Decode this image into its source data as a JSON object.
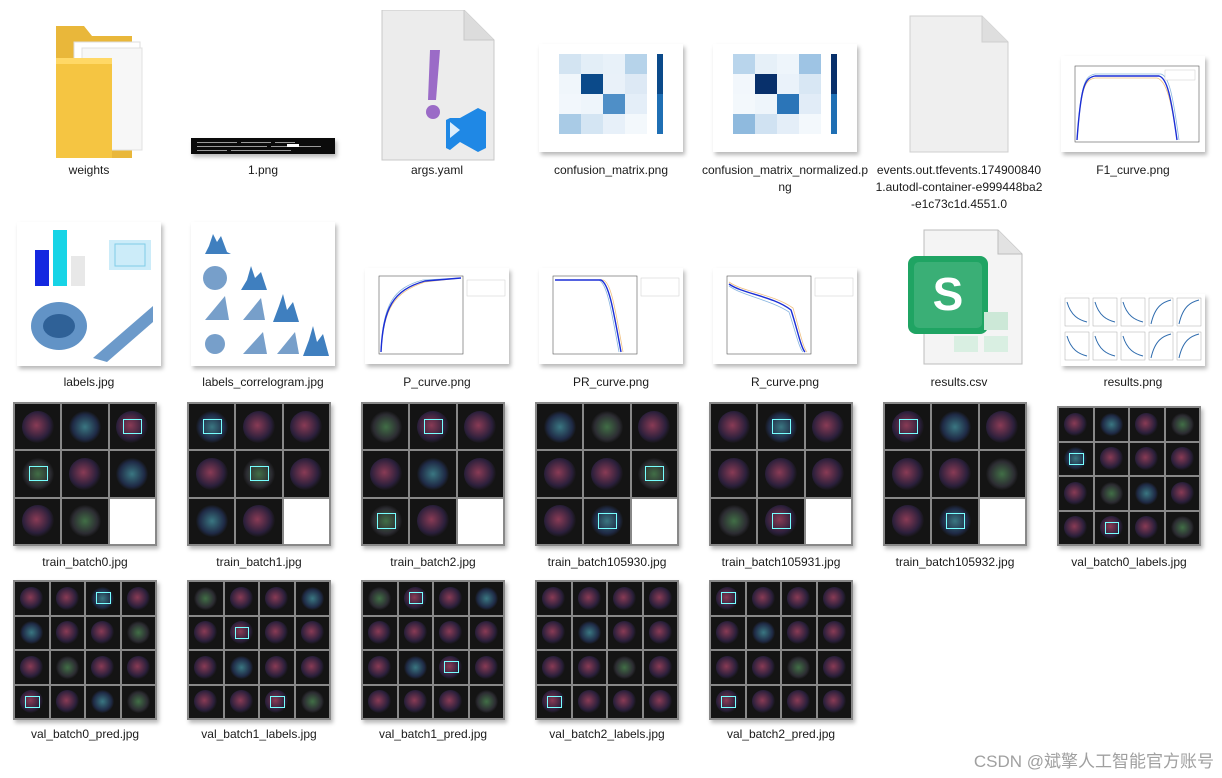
{
  "files": [
    {
      "name": "weights",
      "icon": "folder-icon"
    },
    {
      "name": "1.png",
      "icon": "terminal-screenshot-thumbnail"
    },
    {
      "name": "args.yaml",
      "icon": "vscode-yaml-file-icon"
    },
    {
      "name": "confusion_matrix.png",
      "icon": "heatmap-thumbnail"
    },
    {
      "name": "confusion_matrix_normalized.png",
      "icon": "heatmap-thumbnail"
    },
    {
      "name": "events.out.tfevents.1749008401.autodl-container-e999448ba2-e1c73c1d.4551.0",
      "icon": "blank-file-icon"
    },
    {
      "name": "F1_curve.png",
      "icon": "curve-chart-thumbnail"
    },
    {
      "name": "labels.jpg",
      "icon": "labels-chart-thumbnail"
    },
    {
      "name": "labels_correlogram.jpg",
      "icon": "correlogram-thumbnail"
    },
    {
      "name": "P_curve.png",
      "icon": "curve-chart-thumbnail"
    },
    {
      "name": "PR_curve.png",
      "icon": "curve-chart-thumbnail"
    },
    {
      "name": "R_curve.png",
      "icon": "curve-chart-thumbnail"
    },
    {
      "name": "results.csv",
      "icon": "spreadsheet-file-icon"
    },
    {
      "name": "results.png",
      "icon": "results-grid-thumbnail"
    },
    {
      "name": "train_batch0.jpg",
      "icon": "image-mosaic-thumbnail"
    },
    {
      "name": "train_batch1.jpg",
      "icon": "image-mosaic-thumbnail"
    },
    {
      "name": "train_batch2.jpg",
      "icon": "image-mosaic-thumbnail"
    },
    {
      "name": "train_batch105930.jpg",
      "icon": "image-mosaic-thumbnail"
    },
    {
      "name": "train_batch105931.jpg",
      "icon": "image-mosaic-thumbnail"
    },
    {
      "name": "train_batch105932.jpg",
      "icon": "image-mosaic-thumbnail"
    },
    {
      "name": "val_batch0_labels.jpg",
      "icon": "image-mosaic-thumbnail"
    },
    {
      "name": "val_batch0_pred.jpg",
      "icon": "image-mosaic-thumbnail"
    },
    {
      "name": "val_batch1_labels.jpg",
      "icon": "image-mosaic-thumbnail"
    },
    {
      "name": "val_batch1_pred.jpg",
      "icon": "image-mosaic-thumbnail"
    },
    {
      "name": "val_batch2_labels.jpg",
      "icon": "image-mosaic-thumbnail"
    },
    {
      "name": "val_batch2_pred.jpg",
      "icon": "image-mosaic-thumbnail"
    }
  ],
  "watermark": "CSDN @斌擎人工智能官方账号",
  "colors": {
    "folder": "#f5c542",
    "vscode_blue": "#1f88e5",
    "yaml_purple": "#9b6bc7",
    "sheet_green": "#1fa463",
    "heatmap_blue": "#1f6fb4"
  }
}
